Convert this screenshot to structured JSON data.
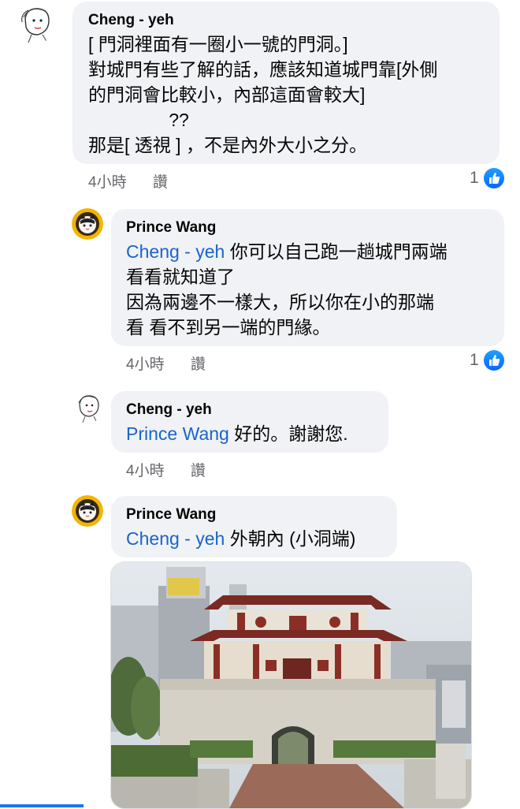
{
  "comments": [
    {
      "author": "Cheng - yeh",
      "lines": [
        "[ 門洞裡面有一圈小一號的門洞。]",
        "對城門有些了解的話，應該知道城門靠[外側",
        "的門洞會比較小，內部這面會較大]",
        "                ??",
        "那是[ 透視 ] ，不是內外大小之分。"
      ],
      "time": "4小時",
      "action": "讚",
      "likes": "1"
    },
    {
      "author": "Prince Wang",
      "mention": "Cheng - yeh",
      "lines": [
        " 你可以自己跑一趟城門兩端",
        "看看就知道了",
        "因為兩邊不一樣大，所以你在小的那端",
        "看 看不到另一端的門緣。"
      ],
      "time": "4小時",
      "action": "讚",
      "likes": "1"
    },
    {
      "author": "Cheng - yeh",
      "mention": "Prince Wang",
      "lines": [
        " 好的。謝謝您."
      ],
      "time": "4小時",
      "action": "讚"
    },
    {
      "author": "Prince Wang",
      "mention": "Cheng - yeh",
      "lines": [
        " 外朝內 (小洞端)"
      ],
      "has_photo": true
    }
  ],
  "colors": {
    "mention": "#1b64c9",
    "bubble": "#f0f2f5",
    "like": "#0866ff"
  }
}
